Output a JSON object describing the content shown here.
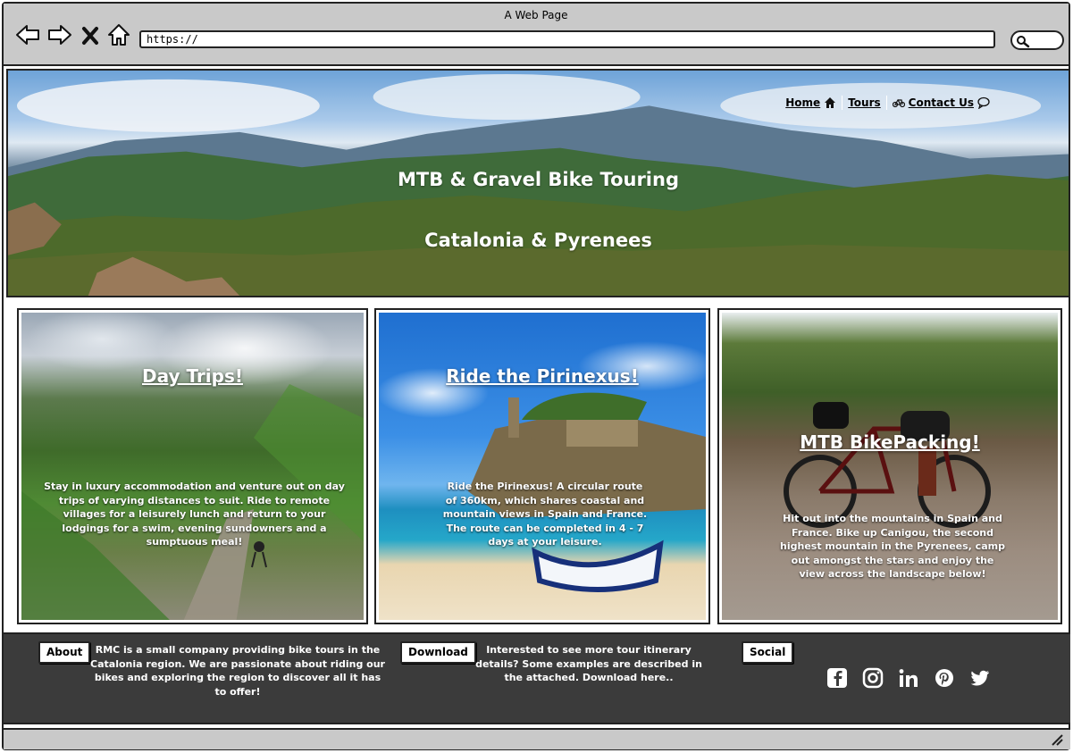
{
  "window": {
    "title": "A Web Page",
    "url": "https://"
  },
  "nav": {
    "home": "Home",
    "tours": "Tours",
    "contact": "Contact Us"
  },
  "hero": {
    "title": "MTB & Gravel Bike Touring",
    "subtitle": "Catalonia & Pyrenees"
  },
  "cards": [
    {
      "heading": "Day Trips!",
      "text": "Stay in luxury accommodation and venture out on day trips of varying distances to suit. Ride to remote villages for a leisurely lunch and return to your lodgings for a swim, evening sundowners and a sumptuous meal!"
    },
    {
      "heading": "Ride the Pirinexus!",
      "text": "Ride the Pirinexus! A circular route of 360km, which shares coastal and mountain views in Spain and France. The route can be completed in 4 - 7 days at your leisure."
    },
    {
      "heading": "MTB BikePacking!",
      "text": "Hit out into the mountains in Spain and France. Bike up Canigou, the second highest mountain in the Pyrenees, camp out amongst the stars and enjoy the view across the landscape below!"
    }
  ],
  "footer": {
    "about_label": "About",
    "about_text": "RMC is a small company providing bike tours in the Catalonia region. We are passionate about riding our bikes and exploring the region to discover all it has to offer!",
    "download_label": "Download",
    "download_text": "Interested to see more tour itinerary details? Some examples are described in the attached. Download here..",
    "social_label": "Social",
    "social_icons": [
      "facebook-icon",
      "instagram-icon",
      "linkedin-icon",
      "pinterest-icon",
      "twitter-icon"
    ]
  }
}
